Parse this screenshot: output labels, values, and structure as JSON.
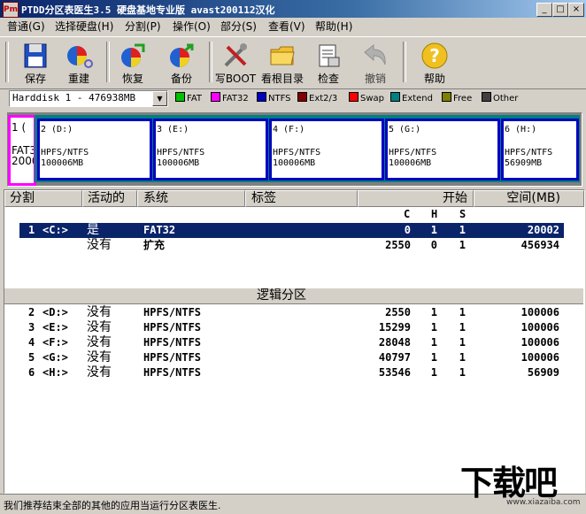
{
  "window": {
    "icon_text": "Pm",
    "title": "PTDD分区表医生3.5 硬盘基地专业版 avast200112汉化",
    "controls": [
      "_",
      "□",
      "×"
    ]
  },
  "menu": [
    "普通(G)",
    "选择硬盘(H)",
    "分割(P)",
    "操作(O)",
    "部分(S)",
    "查看(V)",
    "帮助(H)"
  ],
  "toolbar": {
    "save": "保存",
    "rebuild": "重建",
    "restore": "恢复",
    "backup": "备份",
    "writeboot": "写BOOT",
    "rootdir": "看根目录",
    "check": "检查",
    "undo": "撤销",
    "help": "帮助"
  },
  "disk_select": "Harddisk 1 - 476938MB",
  "legend": [
    {
      "label": "FAT",
      "color": "#00c000"
    },
    {
      "label": "FAT32",
      "color": "#ff00ff"
    },
    {
      "label": "NTFS",
      "color": "#0000c0"
    },
    {
      "label": "Ext2/3",
      "color": "#800000"
    },
    {
      "label": "Swap",
      "color": "#ff0000"
    },
    {
      "label": "Extend",
      "color": "#008080"
    },
    {
      "label": "Free",
      "color": "#808000"
    },
    {
      "label": "Other",
      "color": "#404040"
    }
  ],
  "diskmap": {
    "p1": {
      "hd": "1 (",
      "fs": "FAT3",
      "sz": "2000"
    },
    "parts": [
      {
        "hd": "2 (D:)",
        "fs": "HPFS/NTFS",
        "sz": "100006MB"
      },
      {
        "hd": "3 (E:)",
        "fs": "HPFS/NTFS",
        "sz": "100006MB"
      },
      {
        "hd": "4 (F:)",
        "fs": "HPFS/NTFS",
        "sz": "100006MB"
      },
      {
        "hd": "5 (G:)",
        "fs": "HPFS/NTFS",
        "sz": "100006MB"
      },
      {
        "hd": "6 (H:)",
        "fs": "HPFS/NTFS",
        "sz": "56909MB"
      }
    ]
  },
  "columns": {
    "split": "分割",
    "active": "活动的",
    "system": "系统",
    "label": "标签",
    "start": "开始",
    "space": "空间(MB)"
  },
  "chs": {
    "c": "C",
    "h": "H",
    "s": "S"
  },
  "primary_rows": [
    {
      "no": "1",
      "drv": "<C:>",
      "active": "是",
      "sys": "FAT32",
      "c": "0",
      "h": "1",
      "s": "1",
      "size": "20002"
    },
    {
      "no": "",
      "drv": "",
      "active": "没有",
      "sys": "扩充",
      "c": "2550",
      "h": "0",
      "s": "1",
      "size": "456934"
    }
  ],
  "logical_title": "逻辑分区",
  "logical_rows": [
    {
      "no": "2",
      "drv": "<D:>",
      "active": "没有",
      "sys": "HPFS/NTFS",
      "c": "2550",
      "h": "1",
      "s": "1",
      "size": "100006"
    },
    {
      "no": "3",
      "drv": "<E:>",
      "active": "没有",
      "sys": "HPFS/NTFS",
      "c": "15299",
      "h": "1",
      "s": "1",
      "size": "100006"
    },
    {
      "no": "4",
      "drv": "<F:>",
      "active": "没有",
      "sys": "HPFS/NTFS",
      "c": "28048",
      "h": "1",
      "s": "1",
      "size": "100006"
    },
    {
      "no": "5",
      "drv": "<G:>",
      "active": "没有",
      "sys": "HPFS/NTFS",
      "c": "40797",
      "h": "1",
      "s": "1",
      "size": "100006"
    },
    {
      "no": "6",
      "drv": "<H:>",
      "active": "没有",
      "sys": "HPFS/NTFS",
      "c": "53546",
      "h": "1",
      "s": "1",
      "size": "56909"
    }
  ],
  "status": "我们推荐结束全部的其他的应用当运行分区表医生.",
  "watermark": {
    "big": "下载吧",
    "small": "www.xiazaiba.com"
  }
}
